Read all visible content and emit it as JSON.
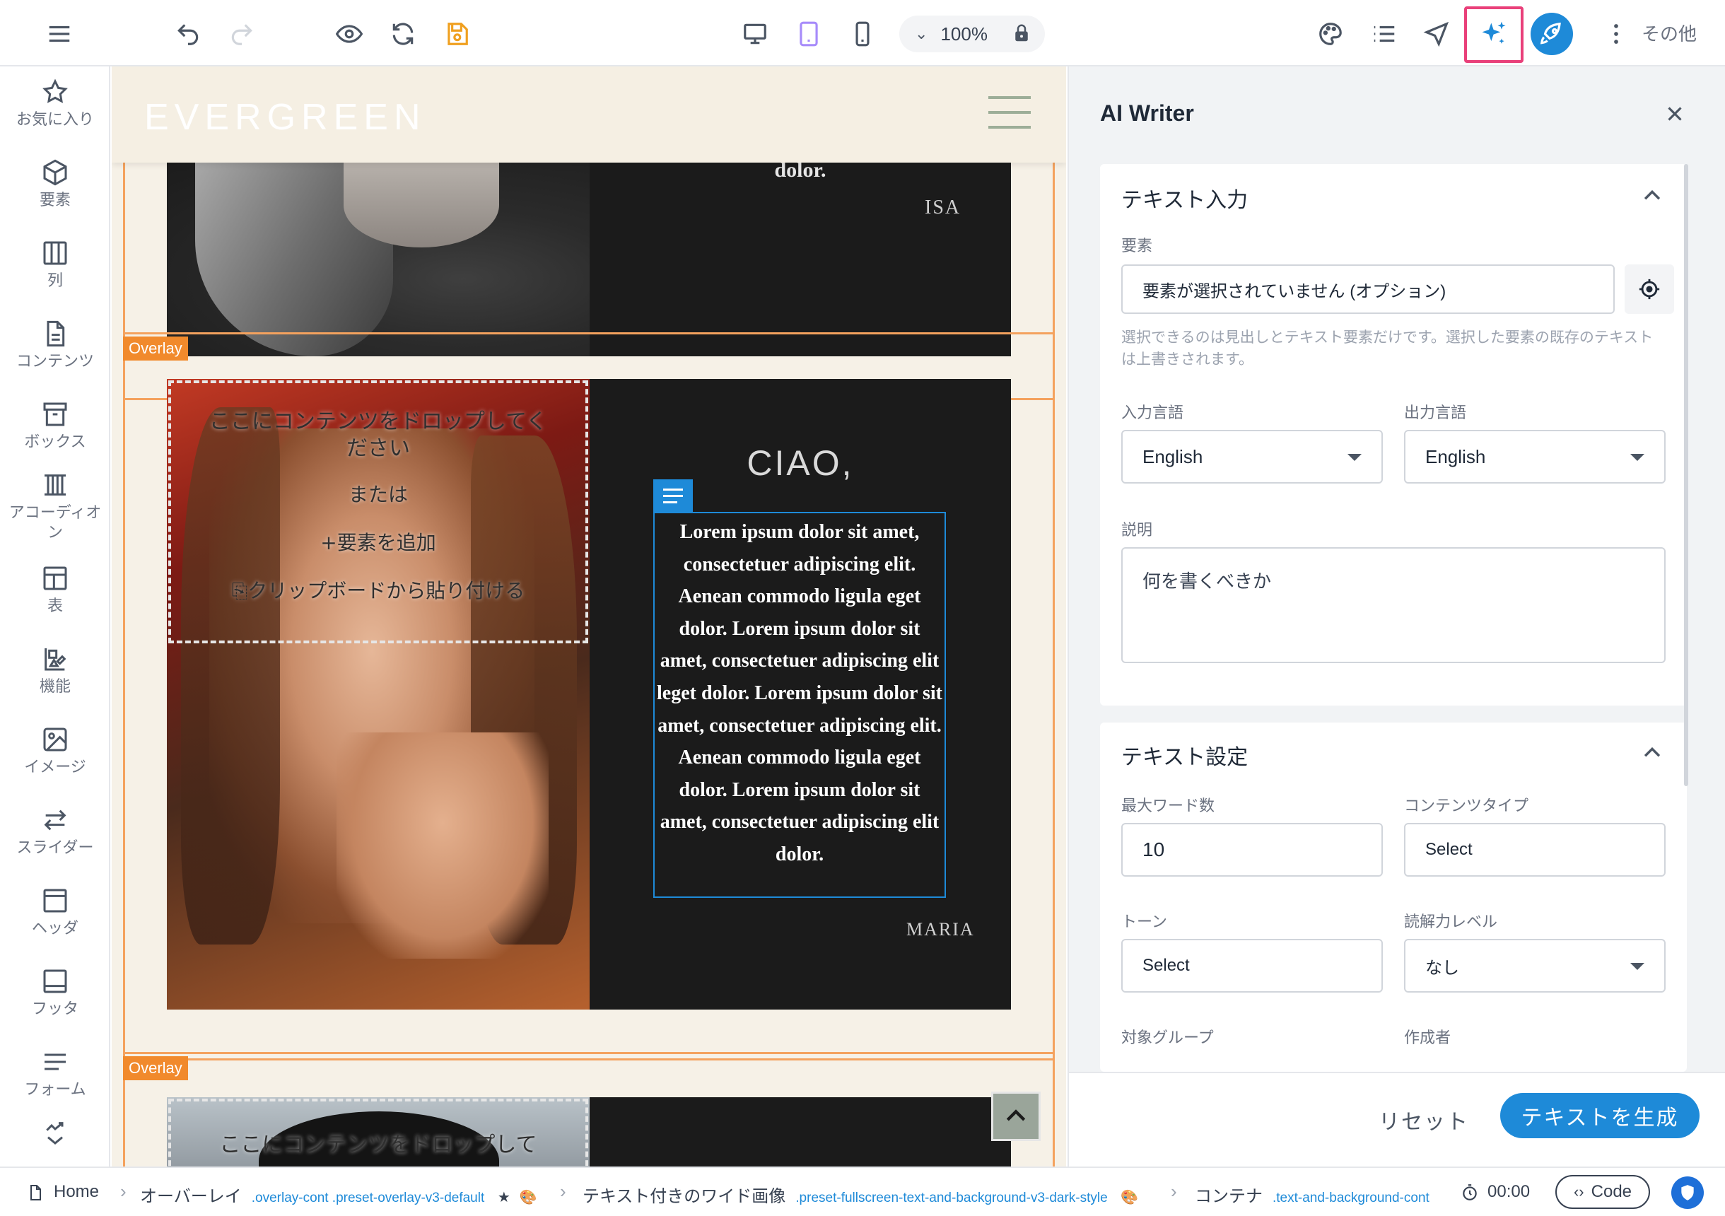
{
  "toolbar": {
    "zoom": "100%",
    "more_label": "その他",
    "active_device": "tablet",
    "accent_color": "#1e8ad8",
    "highlight_color": "#e9407a"
  },
  "sidebar": {
    "items": [
      {
        "label": "お気に入り",
        "icon": "star-icon"
      },
      {
        "label": "要素",
        "icon": "cube-icon"
      },
      {
        "label": "列",
        "icon": "columns-icon"
      },
      {
        "label": "コンテンツ",
        "icon": "document-icon"
      },
      {
        "label": "ボックス",
        "icon": "box-icon"
      },
      {
        "label": "アコーディオン",
        "icon": "accordion-icon"
      },
      {
        "label": "表",
        "icon": "table-icon"
      },
      {
        "label": "機能",
        "icon": "features-icon"
      },
      {
        "label": "イメージ",
        "icon": "image-icon"
      },
      {
        "label": "スライダー",
        "icon": "slider-icon"
      },
      {
        "label": "ヘッダ",
        "icon": "header-icon"
      },
      {
        "label": "フッタ",
        "icon": "footer-icon"
      },
      {
        "label": "フォーム",
        "icon": "form-icon"
      }
    ]
  },
  "canvas": {
    "brand": "EVERGREEN",
    "overlay_tag": "Overlay",
    "section1": {
      "heading_fragment": "dolor.",
      "signature": "ISA"
    },
    "section2": {
      "heading": "CIAO,",
      "body": "Lorem ipsum dolor sit amet, consectetuer adipiscing elit. Aenean commodo ligula eget dolor. Lorem ipsum dolor sit amet, consectetuer adipiscing elit leget dolor. Lorem ipsum dolor sit amet, consectetuer adipiscing elit. Aenean commodo ligula eget dolor. Lorem ipsum dolor sit amet, consectetuer adipiscing elit dolor.",
      "signature": "MARIA"
    },
    "dropzone": {
      "title": "ここにコンテンツをドロップしてください",
      "or": "または",
      "add_element": "要素を追加",
      "paste": "クリップボードから貼り付ける"
    },
    "section3": {
      "dropzone_title": "ここにコンテンツをドロップして"
    }
  },
  "panel": {
    "title": "AI Writer",
    "text_input": {
      "title": "テキスト入力",
      "element_label": "要素",
      "element_value": "要素が選択されていません (オプション)",
      "hint": "選択できるのは見出しとテキスト要素だけです。選択した要素の既存のテキストは上書きされます。",
      "input_lang_label": "入力言語",
      "input_lang_value": "English",
      "output_lang_label": "出力言語",
      "output_lang_value": "English",
      "description_label": "説明",
      "description_placeholder": "何を書くべきか"
    },
    "text_settings": {
      "title": "テキスト設定",
      "max_words_label": "最大ワード数",
      "max_words_value": "10",
      "content_type_label": "コンテンツタイプ",
      "content_type_value": "Select",
      "tone_label": "トーン",
      "tone_value": "Select",
      "reading_level_label": "読解力レベル",
      "reading_level_value": "なし",
      "target_group_label": "対象グループ",
      "author_label": "作成者"
    },
    "reset_label": "リセット",
    "generate_label": "テキストを生成"
  },
  "statusbar": {
    "home": "Home",
    "crumbs": [
      {
        "label": "オーバーレイ",
        "cls": ".overlay-cont .preset-overlay-v3-default"
      },
      {
        "label": "テキスト付きのワイド画像",
        "cls": ".preset-fullscreen-text-and-background-v3-dark-style"
      },
      {
        "label": "コンテナ",
        "cls": ".text-and-background-cont"
      }
    ],
    "timer": "00:00",
    "code_label": "Code"
  }
}
